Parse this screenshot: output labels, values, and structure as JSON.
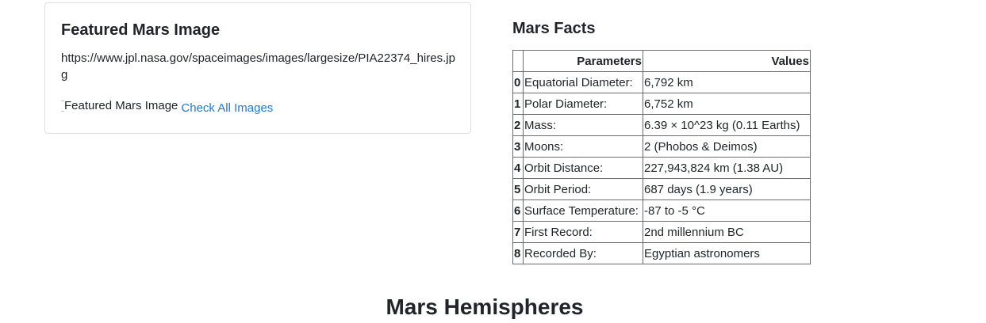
{
  "featured": {
    "title": "Featured Mars Image",
    "url": "https://www.jpl.nasa.gov/spaceimages/images/largesize/PIA22374_hires.jpg",
    "image_alt": "Featured Mars Image",
    "link_label": "Check All Images"
  },
  "facts": {
    "title": "Mars Facts",
    "headers": [
      "",
      "Parameters",
      "Values"
    ],
    "rows": [
      {
        "index": "0",
        "parameter": "Equatorial Diameter:",
        "value": "6,792 km"
      },
      {
        "index": "1",
        "parameter": "Polar Diameter:",
        "value": "6,752 km"
      },
      {
        "index": "2",
        "parameter": "Mass:",
        "value": "6.39 × 10^23 kg (0.11 Earths)"
      },
      {
        "index": "3",
        "parameter": "Moons:",
        "value": "2 (Phobos & Deimos)"
      },
      {
        "index": "4",
        "parameter": "Orbit Distance:",
        "value": "227,943,824 km (1.38 AU)"
      },
      {
        "index": "5",
        "parameter": "Orbit Period:",
        "value": "687 days (1.9 years)"
      },
      {
        "index": "6",
        "parameter": "Surface Temperature:",
        "value": "-87 to -5 °C"
      },
      {
        "index": "7",
        "parameter": "First Record:",
        "value": "2nd millennium BC"
      },
      {
        "index": "8",
        "parameter": "Recorded By:",
        "value": "Egyptian astronomers"
      }
    ]
  },
  "hemispheres": {
    "title": "Mars Hemispheres"
  },
  "colors": {
    "link": "#1f7ad6",
    "text": "#212529",
    "table_border": "#6c6c6c"
  }
}
